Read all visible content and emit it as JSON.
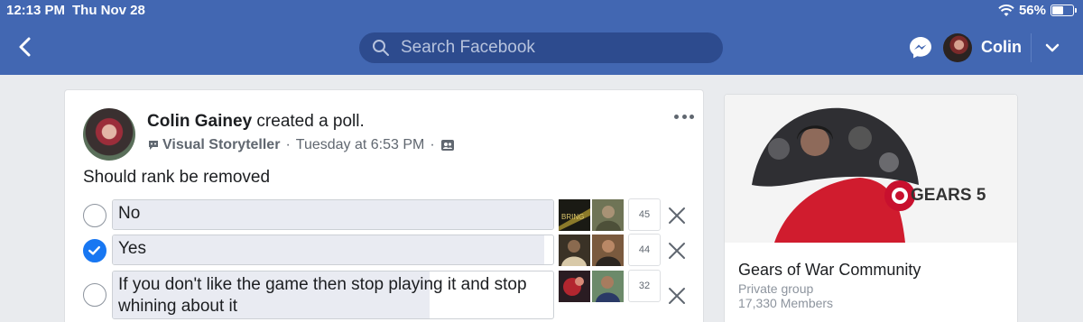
{
  "status": {
    "time": "12:13 PM",
    "date": "Thu Nov 28",
    "battery": "56%",
    "battery_level": 0.56
  },
  "header": {
    "search_placeholder": "Search Facebook",
    "user_name": "Colin"
  },
  "post": {
    "author": "Colin Gainey",
    "action": "created a poll.",
    "badge": "Visual Storyteller",
    "time": "Tuesday at 6:53 PM",
    "separator": "·",
    "question": "Should rank be removed",
    "options": [
      {
        "label": "No",
        "votes": "45",
        "fill": 1.0,
        "checked": false
      },
      {
        "label": "Yes",
        "votes": "44",
        "fill": 0.98,
        "checked": true
      },
      {
        "label": "If you don't like the game then stop playing it and stop whining about it",
        "votes": "32",
        "fill": 0.72,
        "checked": false
      }
    ],
    "voter_thumb_text": "BRING"
  },
  "group": {
    "banner_title": "GEARS 5",
    "name": "Gears of War Community",
    "privacy": "Private group",
    "members": "17,330 Members"
  },
  "colors": {
    "header": "#4267b2",
    "search": "#2d4b8e",
    "accent": "#1877f2",
    "banner_red": "#c8102e"
  }
}
